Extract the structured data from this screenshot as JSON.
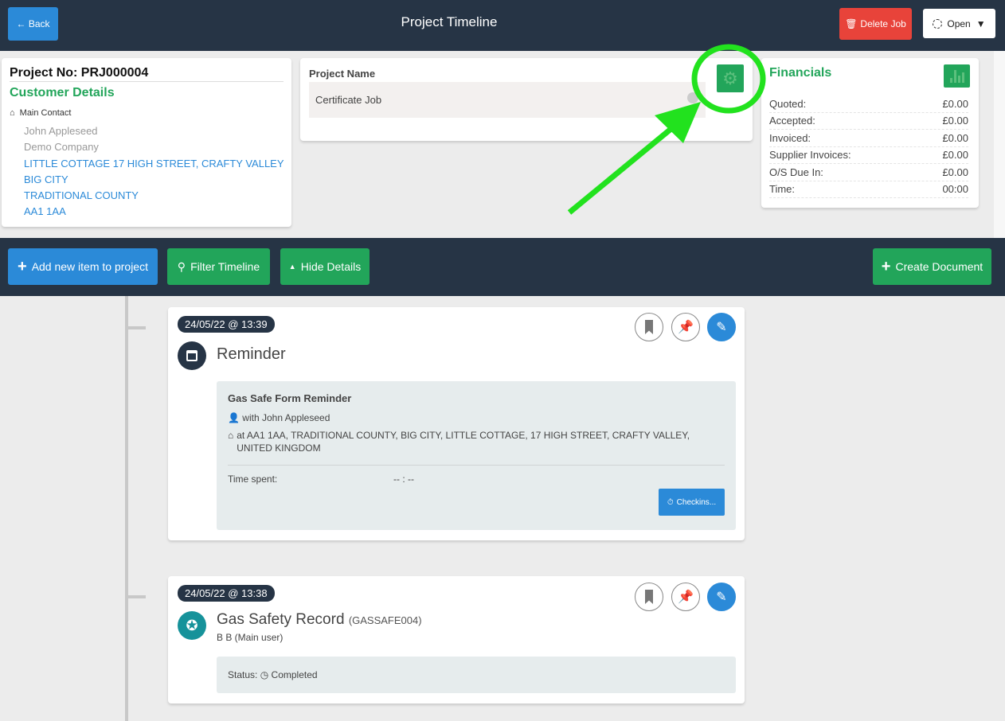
{
  "header": {
    "back_label": "← Back",
    "title": "Project Timeline",
    "delete_label": "Delete Job",
    "status_label": "Open"
  },
  "customer": {
    "project_no": "Project No: PRJ000004",
    "heading": "Customer Details",
    "contact_label": "Main Contact",
    "name": "John Appleseed",
    "company": "Demo Company",
    "address": [
      "LITTLE COTTAGE 17 HIGH STREET, CRAFTY VALLEY",
      "BIG CITY",
      "TRADITIONAL COUNTY",
      "AA1 1AA"
    ]
  },
  "project": {
    "label": "Project Name",
    "value": "Certificate Job"
  },
  "financials": {
    "heading": "Financials",
    "rows": [
      {
        "k": "Quoted:",
        "v": "£0.00"
      },
      {
        "k": "Accepted:",
        "v": "£0.00"
      },
      {
        "k": "Invoiced:",
        "v": "£0.00"
      },
      {
        "k": "Supplier Invoices:",
        "v": "£0.00"
      },
      {
        "k": "O/S Due In:",
        "v": "£0.00"
      },
      {
        "k": "Time:",
        "v": "00:00"
      }
    ]
  },
  "toolbar": {
    "add_label": "Add new item to project",
    "filter_label": "Filter Timeline",
    "hide_label": "Hide Details",
    "create_label": "Create Document"
  },
  "timeline": [
    {
      "date": "24/05/22 @ 13:39",
      "title": "Reminder",
      "subject": "Gas Safe Form Reminder",
      "with": "with John Appleseed",
      "at": "at AA1 1AA, TRADITIONAL COUNTY, BIG CITY, LITTLE COTTAGE, 17 HIGH STREET, CRAFTY VALLEY, UNITED KINGDOM",
      "time_label": "Time spent:",
      "time_value": "-- : --",
      "checkins_label": "Checkins..."
    },
    {
      "date": "24/05/22 @ 13:38",
      "title": "Gas Safety Record",
      "code": "(GASSAFE004)",
      "user": "B B (Main user)",
      "status_label": "Status:",
      "status_value": "Completed"
    }
  ],
  "colors": {
    "dark": "#263445",
    "green": "#22a55a",
    "blue": "#2b8ad8",
    "red": "#e8433a",
    "annotation": "#22e21e"
  }
}
